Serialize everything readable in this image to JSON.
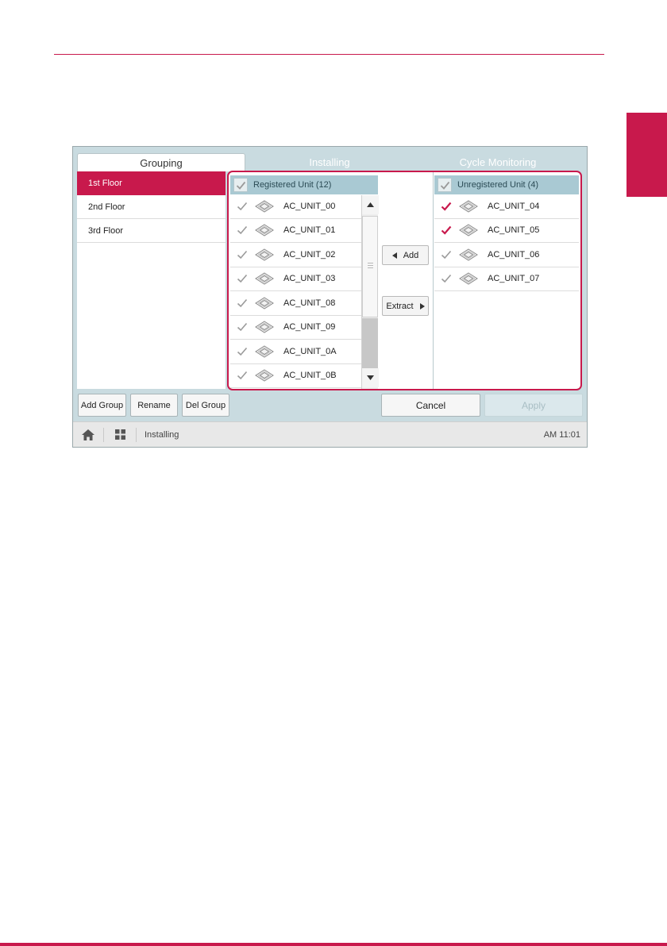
{
  "tabs": [
    {
      "label": "Grouping",
      "active": true
    },
    {
      "label": "Installing",
      "active": false
    },
    {
      "label": "Cycle Monitoring",
      "active": false
    }
  ],
  "groups": [
    {
      "label": "1st Floor",
      "selected": true
    },
    {
      "label": "2nd Floor",
      "selected": false
    },
    {
      "label": "3rd Floor",
      "selected": false
    }
  ],
  "registered": {
    "header": "Registered Unit (12)",
    "items": [
      {
        "name": "AC_UNIT_00",
        "checked": false
      },
      {
        "name": "AC_UNIT_01",
        "checked": false
      },
      {
        "name": "AC_UNIT_02",
        "checked": false
      },
      {
        "name": "AC_UNIT_03",
        "checked": false
      },
      {
        "name": "AC_UNIT_08",
        "checked": false
      },
      {
        "name": "AC_UNIT_09",
        "checked": false
      },
      {
        "name": "AC_UNIT_0A",
        "checked": false
      },
      {
        "name": "AC_UNIT_0B",
        "checked": false
      }
    ]
  },
  "unregistered": {
    "header": "Unregistered Unit (4)",
    "items": [
      {
        "name": "AC_UNIT_04",
        "checked": true
      },
      {
        "name": "AC_UNIT_05",
        "checked": true
      },
      {
        "name": "AC_UNIT_06",
        "checked": false
      },
      {
        "name": "AC_UNIT_07",
        "checked": false
      }
    ]
  },
  "actions": {
    "add": "Add",
    "extract": "Extract"
  },
  "group_buttons": {
    "add_group": "Add Group",
    "rename": "Rename",
    "del_group": "Del Group"
  },
  "dialog_buttons": {
    "cancel": "Cancel",
    "apply": "Apply"
  },
  "statusbar": {
    "location": "Installing",
    "time": "AM 11:01"
  },
  "colors": {
    "accent": "#c8194c",
    "check_muted": "#9a9a9a",
    "panel_bg": "#c9dbe0",
    "header_bg": "#a9c9d3"
  }
}
